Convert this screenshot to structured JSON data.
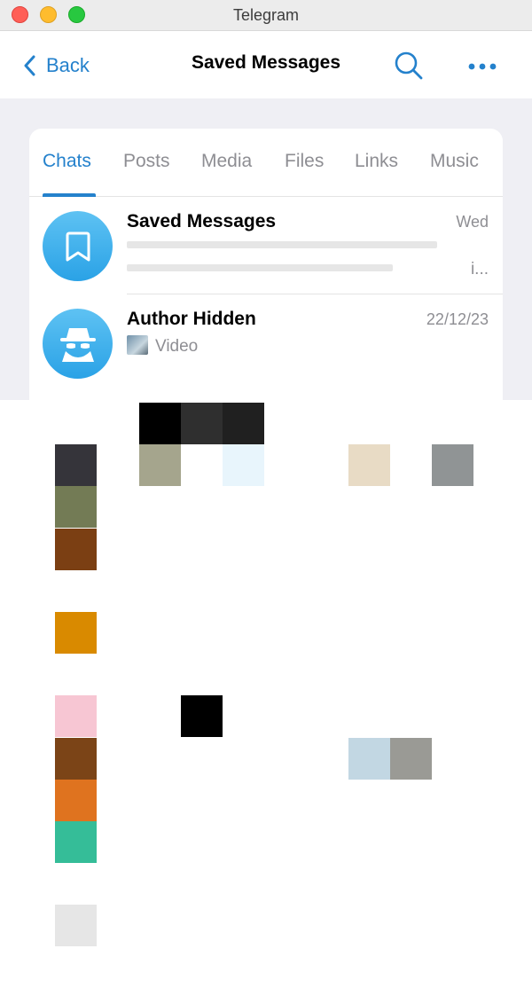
{
  "window": {
    "title": "Telegram"
  },
  "nav": {
    "back_label": "Back",
    "title": "Saved Messages"
  },
  "tabs": [
    {
      "label": "Chats",
      "active": true
    },
    {
      "label": "Posts",
      "active": false
    },
    {
      "label": "Media",
      "active": false
    },
    {
      "label": "Files",
      "active": false
    },
    {
      "label": "Links",
      "active": false
    },
    {
      "label": "Music",
      "active": false
    }
  ],
  "chats": [
    {
      "name": "Saved Messages",
      "date": "Wed",
      "preview": "i...",
      "avatar_icon": "bookmark-icon"
    },
    {
      "name": "Author Hidden",
      "date": "22/12/23",
      "preview": "Video",
      "avatar_icon": "incognito-icon"
    }
  ],
  "colors": {
    "accent": "#2481cc",
    "secondary_text": "#8e8e93",
    "background": "#efeff4",
    "avatar": "#3aaee9"
  },
  "pixel_blocks": [
    "#000000",
    "#2f2f2f",
    "#202020",
    "#35343a",
    "#a5a58d",
    "#e8f5fc",
    "#e8dbc5",
    "#909495",
    "#737b55",
    "#7b3f13",
    "#d98a00",
    "#f7c6d3",
    "#000000",
    "#7b4417",
    "#c2d7e3",
    "#9a9a95",
    "#df731f",
    "#35bd98",
    "#e6e6e6"
  ]
}
